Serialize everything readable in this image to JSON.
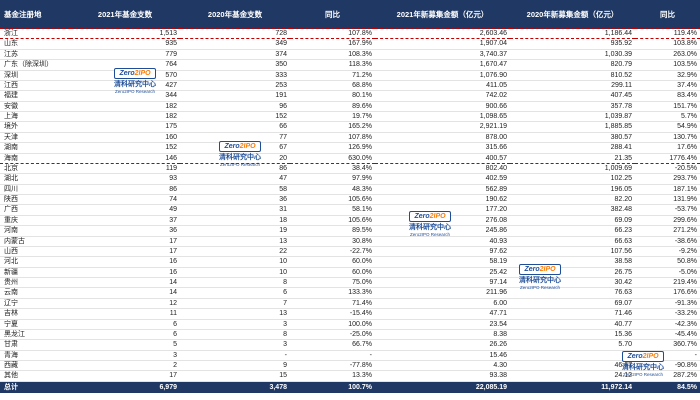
{
  "header": [
    "基金注册地",
    "2021年基金支数",
    "2020年基金支数",
    "同比",
    "2021年新募集金额（亿元）",
    "2020年新募集金额（亿元）",
    "同比"
  ],
  "rows": [
    [
      "浙江",
      "1,513",
      "728",
      "107.8%",
      "2,603.46",
      "1,186.44",
      "119.4%"
    ],
    [
      "山东",
      "935",
      "349",
      "167.9%",
      "1,907.04",
      "935.92",
      "103.8%"
    ],
    [
      "江苏",
      "779",
      "374",
      "108.3%",
      "3,740.37",
      "1,030.39",
      "263.0%"
    ],
    [
      "广东（除深圳）",
      "764",
      "350",
      "118.3%",
      "1,670.47",
      "820.79",
      "103.5%"
    ],
    [
      "深圳",
      "570",
      "333",
      "71.2%",
      "1,076.90",
      "810.52",
      "32.9%"
    ],
    [
      "江西",
      "427",
      "253",
      "68.8%",
      "411.05",
      "299.11",
      "37.4%"
    ],
    [
      "福建",
      "344",
      "191",
      "80.1%",
      "742.02",
      "407.45",
      "83.4%"
    ],
    [
      "安徽",
      "182",
      "96",
      "89.6%",
      "900.66",
      "357.78",
      "151.7%"
    ],
    [
      "上海",
      "182",
      "152",
      "19.7%",
      "1,098.65",
      "1,039.87",
      "5.7%"
    ],
    [
      "境外",
      "175",
      "66",
      "165.2%",
      "2,921.19",
      "1,885.85",
      "54.9%"
    ],
    [
      "天津",
      "160",
      "77",
      "107.8%",
      "878.00",
      "380.57",
      "130.7%"
    ],
    [
      "湖南",
      "152",
      "67",
      "126.9%",
      "315.66",
      "288.41",
      "17.6%"
    ],
    [
      "海南",
      "146",
      "20",
      "630.0%",
      "400.57",
      "21.35",
      "1776.4%"
    ],
    [
      "北京",
      "119",
      "86",
      "38.4%",
      "802.40",
      "1,009.69",
      "-20.5%"
    ],
    [
      "湖北",
      "93",
      "47",
      "97.9%",
      "402.59",
      "102.25",
      "293.7%"
    ],
    [
      "四川",
      "86",
      "58",
      "48.3%",
      "562.89",
      "196.05",
      "187.1%"
    ],
    [
      "陕西",
      "74",
      "36",
      "105.6%",
      "190.62",
      "82.20",
      "131.9%"
    ],
    [
      "广西",
      "49",
      "31",
      "58.1%",
      "177.20",
      "382.48",
      "-53.7%"
    ],
    [
      "重庆",
      "37",
      "18",
      "105.6%",
      "276.08",
      "69.09",
      "299.6%"
    ],
    [
      "河南",
      "36",
      "19",
      "89.5%",
      "245.86",
      "66.23",
      "271.2%"
    ],
    [
      "内蒙古",
      "17",
      "13",
      "30.8%",
      "40.93",
      "66.63",
      "-38.6%"
    ],
    [
      "山西",
      "17",
      "22",
      "-22.7%",
      "97.62",
      "107.56",
      "-9.2%"
    ],
    [
      "河北",
      "16",
      "10",
      "60.0%",
      "58.19",
      "38.58",
      "50.8%"
    ],
    [
      "新疆",
      "16",
      "10",
      "60.0%",
      "25.42",
      "26.75",
      "-5.0%"
    ],
    [
      "贵州",
      "14",
      "8",
      "75.0%",
      "97.14",
      "30.42",
      "219.4%"
    ],
    [
      "云南",
      "14",
      "6",
      "133.3%",
      "211.96",
      "76.63",
      "176.6%"
    ],
    [
      "辽宁",
      "12",
      "7",
      "71.4%",
      "6.00",
      "69.07",
      "-91.3%"
    ],
    [
      "吉林",
      "11",
      "13",
      "-15.4%",
      "47.71",
      "71.46",
      "-33.2%"
    ],
    [
      "宁夏",
      "6",
      "3",
      "100.0%",
      "23.54",
      "40.77",
      "-42.3%"
    ],
    [
      "黑龙江",
      "6",
      "8",
      "-25.0%",
      "8.38",
      "15.36",
      "-45.4%"
    ],
    [
      "甘肃",
      "5",
      "3",
      "66.7%",
      "26.26",
      "5.70",
      "360.7%"
    ],
    [
      "青海",
      "3",
      "-",
      "-",
      "15.46",
      "-",
      "-"
    ],
    [
      "西藏",
      "2",
      "9",
      "-77.8%",
      "4.30",
      "46.67",
      "-90.8%"
    ],
    [
      "其他",
      "17",
      "15",
      "13.3%",
      "93.38",
      "24.12",
      "287.2%"
    ]
  ],
  "total": [
    "总计",
    "6,979",
    "3,478",
    "100.7%",
    "22,085.19",
    "11,972.14",
    "84.5%"
  ],
  "highlight_rows": [
    0,
    12
  ],
  "watermark": {
    "logo": "Zero",
    "logo_accent": "2IPO",
    "cn": "清科研究中心",
    "en": "Zero2IPO Research"
  }
}
